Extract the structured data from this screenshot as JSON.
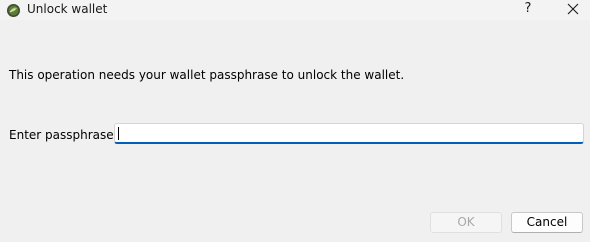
{
  "window": {
    "title": "Unlock wallet",
    "icon": "app-leaf-icon",
    "help_label": "?",
    "close_icon": "close-icon"
  },
  "dialog": {
    "message": "This operation needs your wallet passphrase to unlock the wallet.",
    "passphrase_label": "Enter passphrase",
    "passphrase_value": "",
    "ok_label": "OK",
    "ok_enabled": false,
    "cancel_label": "Cancel"
  },
  "colors": {
    "background": "#f0f0f0",
    "input_focus_accent": "#005fb8",
    "disabled_text": "#a8a8a8"
  }
}
